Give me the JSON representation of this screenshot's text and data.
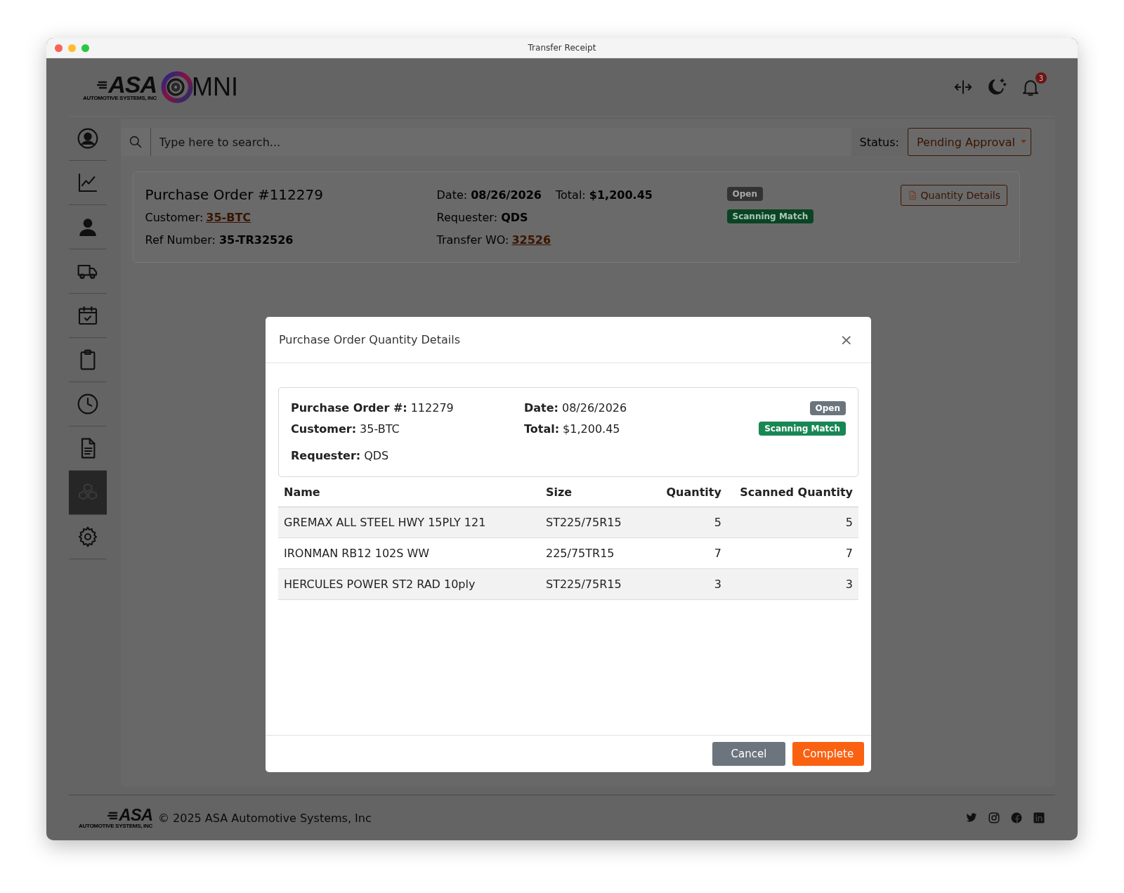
{
  "window": {
    "title": "Transfer Receipt"
  },
  "header": {
    "logo": {
      "brand": "ASA",
      "tagline": "AUTOMOTIVE SYSTEMS, INC",
      "product": "MNI"
    },
    "notification_count": "3"
  },
  "sidebar": {
    "items": [
      {
        "selected": false
      },
      {
        "selected": false
      },
      {
        "selected": false
      },
      {
        "selected": false
      },
      {
        "selected": false
      },
      {
        "selected": false
      },
      {
        "selected": false
      },
      {
        "selected": false
      },
      {
        "selected": true
      },
      {
        "selected": false
      }
    ]
  },
  "search": {
    "placeholder": "Type here to search..."
  },
  "status_filter": {
    "label": "Status:",
    "value": "Pending Approval"
  },
  "order_card": {
    "title": "Purchase Order #112279",
    "columns": [
      [
        [
          {
            "label": "Customer:",
            "value": "35-BTC",
            "kind": "link"
          }
        ],
        [
          {
            "label": "Ref Number:",
            "value": "35-TR32526",
            "kind": "bold"
          }
        ]
      ],
      [
        [
          {
            "label": "Date:",
            "value": "08/26/2026",
            "kind": "bold"
          },
          {
            "label": "Total:",
            "value": "$1,200.45",
            "kind": "bold"
          }
        ],
        [
          {
            "label": "Requester:",
            "value": "QDS",
            "kind": "bold"
          }
        ],
        [
          {
            "label": "Transfer WO:",
            "value": "32526",
            "kind": "link"
          }
        ]
      ]
    ],
    "badges": [
      {
        "text": "Open",
        "kind": "neutral"
      },
      {
        "text": "Scanning Match",
        "kind": "success"
      }
    ],
    "button": "Quantity Details"
  },
  "modal": {
    "title": "Purchase Order Quantity Details",
    "close": "×",
    "info": [
      [
        {
          "label": "Purchase Order #:",
          "value": "112279"
        },
        {
          "label": "Date:",
          "value": "08/26/2026"
        }
      ],
      [
        {
          "label": "Customer:",
          "value": "35-BTC"
        },
        {
          "label": "Total:",
          "value": "$1,200.45"
        }
      ],
      [
        {
          "label": "Requester:",
          "value": "QDS"
        }
      ]
    ],
    "badges": [
      {
        "text": "Open",
        "kind": "neutral"
      },
      {
        "text": "Scanning Match",
        "kind": "success"
      }
    ],
    "table": {
      "columns": [
        "Name",
        "Size",
        "Quantity",
        "Scanned Quantity"
      ],
      "rows": [
        [
          "GREMAX ALL STEEL HWY 15PLY 121",
          "ST225/75R15",
          "5",
          "5"
        ],
        [
          "IRONMAN RB12 102S WW",
          "225/75TR15",
          "7",
          "7"
        ],
        [
          "HERCULES POWER ST2 RAD 10ply",
          "ST225/75R15",
          "3",
          "3"
        ]
      ]
    },
    "buttons": [
      {
        "label": "Cancel",
        "kind": "secondary"
      },
      {
        "label": "Complete",
        "kind": "primary"
      }
    ]
  },
  "footer": {
    "brand": "ASA",
    "tagline": "AUTOMOTIVE SYSTEMS, INC",
    "copyright": "© 2025 ASA Automotive Systems, Inc"
  }
}
